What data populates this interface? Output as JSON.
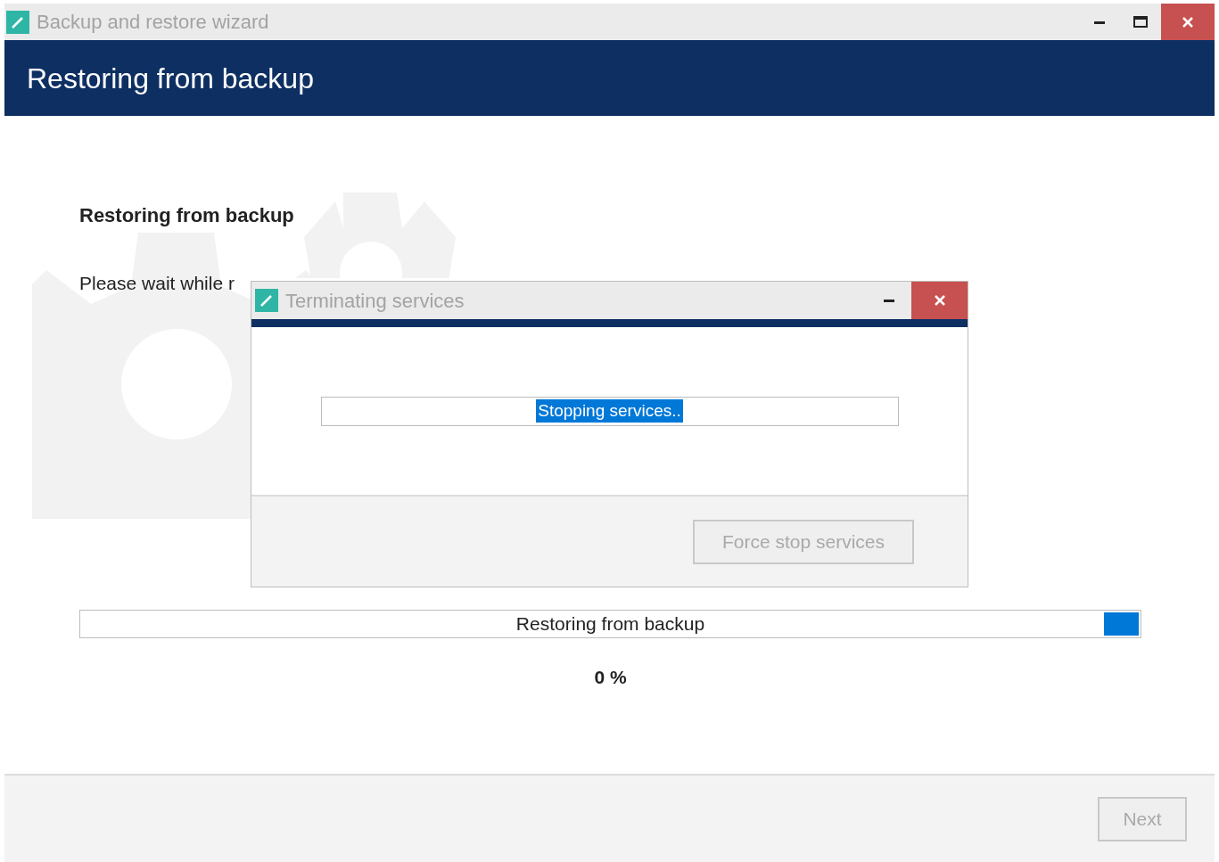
{
  "window": {
    "title": "Backup and restore wizard"
  },
  "header": {
    "title": "Restoring from backup"
  },
  "content": {
    "heading": "Restoring from backup",
    "message": "Please wait while r"
  },
  "progress": {
    "label": "Restoring from backup",
    "indeterminate": true,
    "percent": "0 %"
  },
  "dialog": {
    "title": "Terminating services",
    "status": "Stopping services..",
    "indeterminate": true,
    "button": {
      "label": "Force stop services",
      "disabled": true
    }
  },
  "footer": {
    "buttons": [
      {
        "label": "Next",
        "disabled": true
      }
    ]
  }
}
